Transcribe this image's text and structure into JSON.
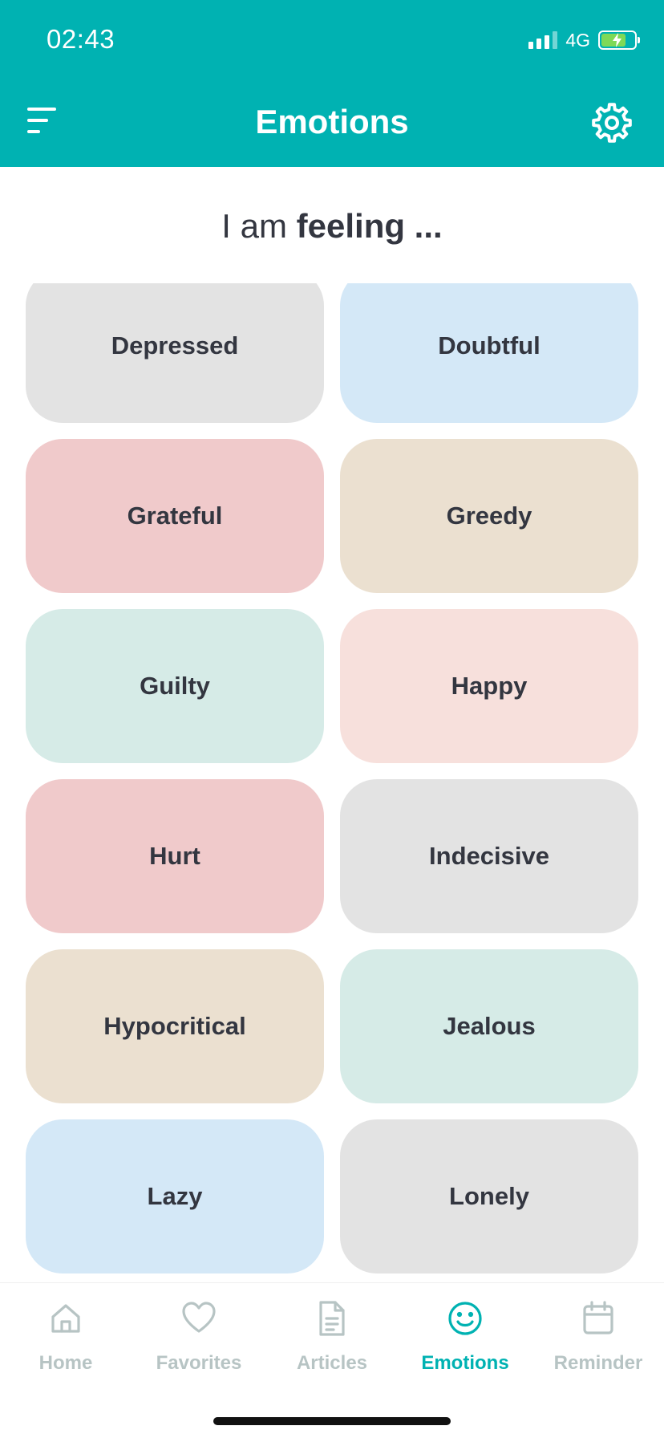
{
  "status_bar": {
    "time": "02:43",
    "network": "4G"
  },
  "header": {
    "title": "Emotions",
    "menu_icon": "menu-icon",
    "settings_icon": "gear-icon"
  },
  "prompt": {
    "prefix": "I am ",
    "emphasis": "feeling ..."
  },
  "emotions": [
    {
      "label": "Depressed",
      "color": "#e3e3e3"
    },
    {
      "label": "Doubtful",
      "color": "#d4e8f7"
    },
    {
      "label": "Grateful",
      "color": "#f0cacb"
    },
    {
      "label": "Greedy",
      "color": "#ebe0d0"
    },
    {
      "label": "Guilty",
      "color": "#d6ebe7"
    },
    {
      "label": "Happy",
      "color": "#f7e0dc"
    },
    {
      "label": "Hurt",
      "color": "#f0cacb"
    },
    {
      "label": "Indecisive",
      "color": "#e3e3e3"
    },
    {
      "label": "Hypocritical",
      "color": "#ebe0d0"
    },
    {
      "label": "Jealous",
      "color": "#d6ebe7"
    },
    {
      "label": "Lazy",
      "color": "#d4e8f7"
    },
    {
      "label": "Lonely",
      "color": "#e3e3e3"
    }
  ],
  "tabs": [
    {
      "label": "Home",
      "icon": "home-icon",
      "active": false
    },
    {
      "label": "Favorites",
      "icon": "heart-icon",
      "active": false
    },
    {
      "label": "Articles",
      "icon": "document-icon",
      "active": false
    },
    {
      "label": "Emotions",
      "icon": "smiley-icon",
      "active": true
    },
    {
      "label": "Reminder",
      "icon": "calendar-icon",
      "active": false
    }
  ],
  "colors": {
    "accent": "#00b2b2",
    "tab_inactive": "#b7c4c4",
    "text": "#333640"
  }
}
